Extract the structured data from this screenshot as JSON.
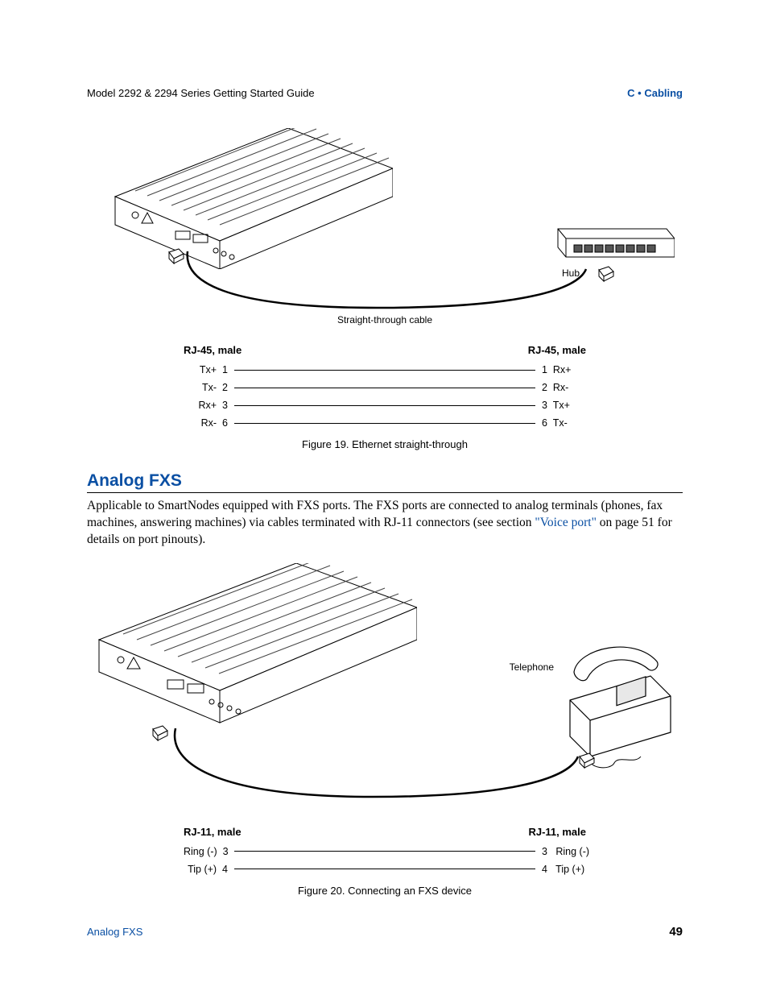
{
  "header": {
    "left": "Model 2292 & 2294 Series Getting Started Guide",
    "right": "C • Cabling"
  },
  "figure19": {
    "hub_label": "Hub",
    "cable_label": "Straight-through cable",
    "left_connector": "RJ-45, male",
    "right_connector": "RJ-45, male",
    "pins": [
      {
        "left_signal": "Tx+",
        "left_pin": "1",
        "right_pin": "1",
        "right_signal": "Rx+"
      },
      {
        "left_signal": "Tx-",
        "left_pin": "2",
        "right_pin": "2",
        "right_signal": "Rx-"
      },
      {
        "left_signal": "Rx+",
        "left_pin": "3",
        "right_pin": "3",
        "right_signal": "Tx+"
      },
      {
        "left_signal": "Rx-",
        "left_pin": "6",
        "right_pin": "6",
        "right_signal": "Tx-"
      }
    ],
    "caption": "Figure 19. Ethernet straight-through"
  },
  "section": {
    "heading": "Analog FXS",
    "body_before_link": "Applicable to SmartNodes equipped with FXS ports. The FXS ports are connected to analog terminals (phones, fax machines, answering machines) via cables terminated with RJ-11 connectors (see section ",
    "link_text": "\"Voice port\"",
    "body_after_link": " on page 51 for details on port pinouts)."
  },
  "figure20": {
    "phone_label": "Telephone",
    "left_connector": "RJ-11, male",
    "right_connector": "RJ-11, male",
    "pins": [
      {
        "left_signal": "Ring (-)",
        "left_pin": "3",
        "right_pin": "3",
        "right_signal": "Ring (-)"
      },
      {
        "left_signal": "Tip (+)",
        "left_pin": "4",
        "right_pin": "4",
        "right_signal": "Tip (+)"
      }
    ],
    "caption": "Figure 20. Connecting an FXS device"
  },
  "footer": {
    "left": "Analog FXS",
    "page": "49"
  }
}
